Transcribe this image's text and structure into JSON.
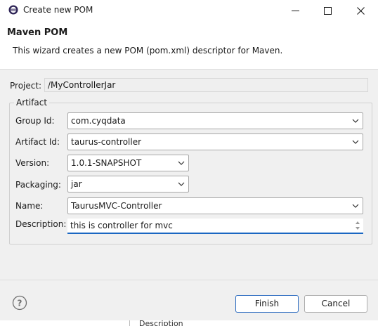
{
  "window": {
    "title": "Create new POM",
    "icon": "eclipse-icon",
    "controls": [
      "minimize-icon",
      "maximize-icon",
      "close-icon"
    ]
  },
  "banner": {
    "title": "Maven POM",
    "description": "This wizard creates a new POM (pom.xml) descriptor for Maven."
  },
  "form": {
    "project": {
      "label": "Project:",
      "value": "/MyControllerJar"
    },
    "artifact_group": "Artifact",
    "group_id": {
      "label": "Group Id:",
      "value": "com.cyqdata"
    },
    "artifact_id": {
      "label": "Artifact Id:",
      "value": "taurus-controller"
    },
    "version": {
      "label": "Version:",
      "value": "1.0.1-SNAPSHOT"
    },
    "packaging": {
      "label": "Packaging:",
      "value": "jar"
    },
    "name": {
      "label": "Name:",
      "value": "TaurusMVC-Controller"
    },
    "description": {
      "label": "Description:",
      "value": "this is controller for mvc"
    }
  },
  "buttons": {
    "help_icon": "help-icon",
    "finish": "Finish",
    "cancel": "Cancel"
  },
  "background": {
    "partial_text": "Description"
  },
  "colors": {
    "focus": "#1a67c2",
    "window_bg": "#f0f0f0"
  }
}
